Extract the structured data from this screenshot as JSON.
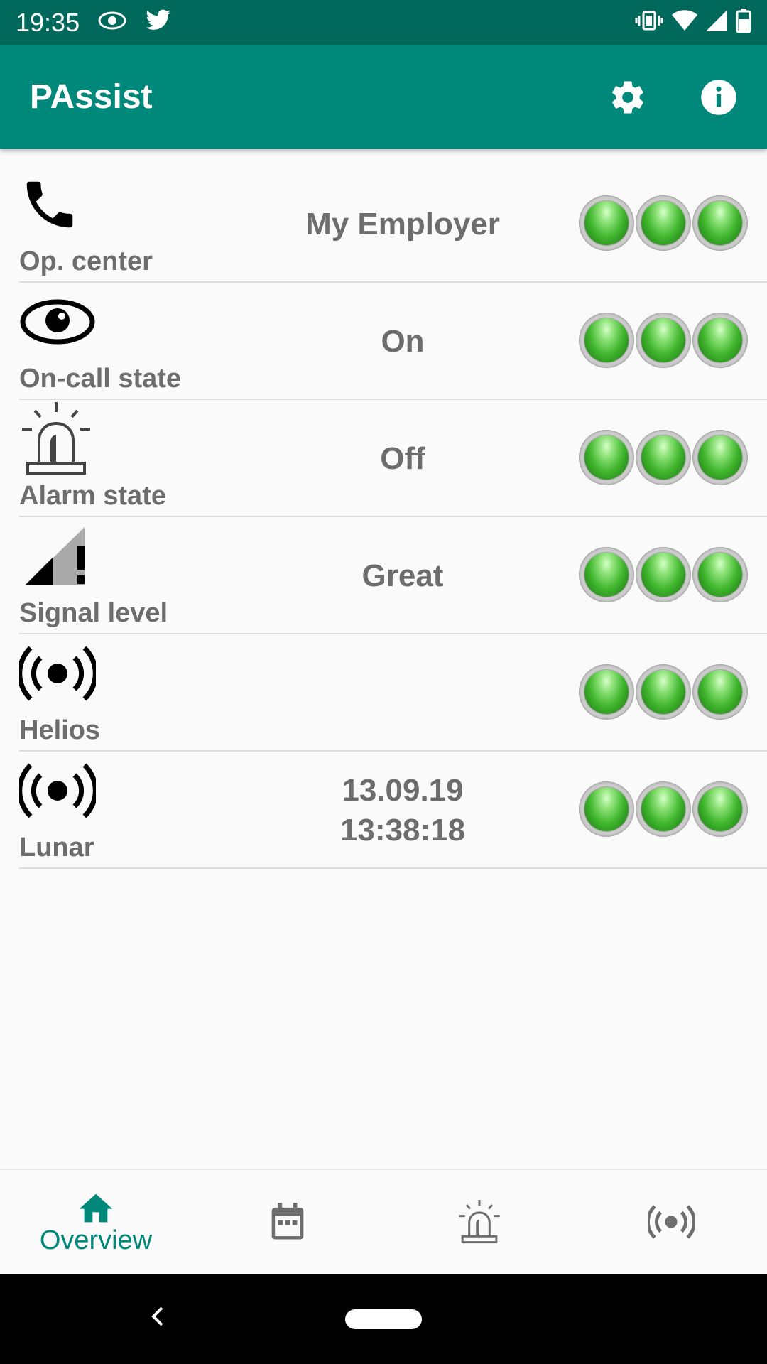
{
  "status_bar": {
    "time": "19:35",
    "icons_left": [
      "eye-icon",
      "twitter-icon"
    ],
    "icons_right": [
      "vibrate-icon",
      "wifi-icon",
      "cell-signal-icon",
      "battery-icon"
    ]
  },
  "app_bar": {
    "title": "PAssist",
    "actions": [
      {
        "name": "settings",
        "icon": "gear-icon"
      },
      {
        "name": "info",
        "icon": "info-icon"
      }
    ]
  },
  "rows": [
    {
      "label": "Op. center",
      "icon": "phone-icon",
      "value_line1": "My Employer",
      "value_line2": "",
      "leds": [
        "green",
        "green",
        "green"
      ]
    },
    {
      "label": "On-call state",
      "icon": "eye-icon",
      "value_line1": "On",
      "value_line2": "",
      "leds": [
        "green",
        "green",
        "green"
      ]
    },
    {
      "label": "Alarm state",
      "icon": "siren-icon",
      "value_line1": "Off",
      "value_line2": "",
      "leds": [
        "green",
        "green",
        "green"
      ]
    },
    {
      "label": "Signal level",
      "icon": "signal-alert-icon",
      "value_line1": "Great",
      "value_line2": "",
      "leds": [
        "green",
        "green",
        "green"
      ]
    },
    {
      "label": "Helios",
      "icon": "broadcast-icon",
      "value_line1": "",
      "value_line2": "",
      "leds": [
        "green",
        "green",
        "green"
      ]
    },
    {
      "label": "Lunar",
      "icon": "broadcast-icon",
      "value_line1": "13.09.19",
      "value_line2": "13:38:18",
      "leds": [
        "green",
        "green",
        "green"
      ]
    }
  ],
  "bottom_nav": {
    "items": [
      {
        "name": "overview",
        "label": "Overview",
        "icon": "home-icon",
        "active": true
      },
      {
        "name": "calendar",
        "label": "",
        "icon": "calendar-icon",
        "active": false
      },
      {
        "name": "alarm",
        "label": "",
        "icon": "siren-icon",
        "active": false
      },
      {
        "name": "broadcast",
        "label": "",
        "icon": "broadcast-icon",
        "active": false
      }
    ]
  },
  "colors": {
    "status_bar": "#00695c",
    "app_bar": "#00897b",
    "accent": "#00897b",
    "led_on": "#3fb52d",
    "text_secondary": "#6d6d6d"
  }
}
